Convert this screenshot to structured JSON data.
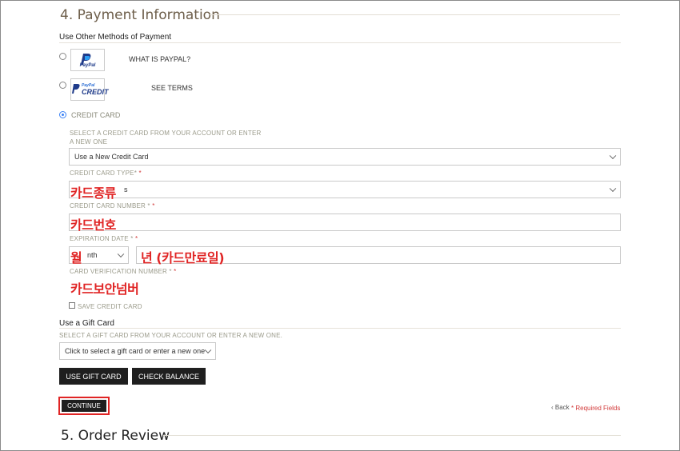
{
  "payment": {
    "title": "4.  Payment Information",
    "other_methods_heading": "Use Other Methods of Payment",
    "paypal_logo": "PayPal",
    "paypal_link": "WHAT IS PAYPAL?",
    "paypal_credit_logo_top": "PayPal",
    "paypal_credit_logo_bottom": "CREDIT",
    "paypal_credit_link": "SEE TERMS",
    "credit_card_label": "CREDIT CARD",
    "select_card_help": "SELECT A CREDIT CARD FROM YOUR ACCOUNT OR ENTER A NEW ONE",
    "card_select_value": "Use a New Credit Card",
    "card_type_label": "CREDIT CARD TYPE*",
    "card_type_value": "s",
    "card_number_label": "CREDIT CARD NUMBER *",
    "expiration_label": "EXPIRATION DATE *",
    "month_value": "nth",
    "cvv_label": "CARD VERIFICATION NUMBER *",
    "save_card_label": "SAVE CREDIT CARD",
    "required_mark": "*"
  },
  "annotations": {
    "card_type": "카드종류",
    "card_number": "카드번호",
    "month": "월",
    "year": "년 (카드만료일)",
    "cvv": "카드보안넘버"
  },
  "gift": {
    "heading": "Use a Gift Card",
    "help": "SELECT A GIFT CARD FROM YOUR ACCOUNT OR ENTER A NEW ONE.",
    "select_value": "Click to select a gift card or enter a new one",
    "use_button": "USE GIFT CARD",
    "balance_button": "CHECK BALANCE"
  },
  "actions": {
    "continue": "CONTINUE",
    "back": "‹ Back",
    "required_note": "* Required Fields"
  },
  "review": {
    "title": "5.  Order Review"
  }
}
